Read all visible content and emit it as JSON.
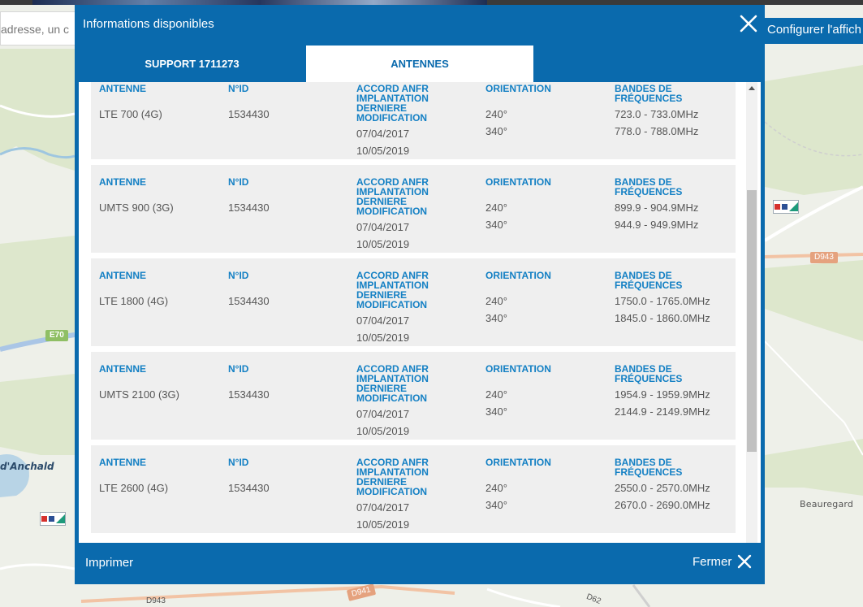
{
  "map": {
    "search_placeholder": "adresse, un c",
    "configure_label": "Configurer l'affich",
    "labels": {
      "anchald": "d'Anchald",
      "beauregard": "Beauregard",
      "e70": "E70",
      "d943": "D943",
      "d943b": "D943",
      "d941": "D941",
      "d62": "D62"
    },
    "colors": {
      "accent": "#0a6aad",
      "land": "#eef0e9",
      "water": "#b8d4e6"
    }
  },
  "dialog": {
    "title": "Informations disponibles",
    "close_icon": "close-icon",
    "tabs": [
      {
        "label": "SUPPORT 1711273",
        "active": false
      },
      {
        "label": "ANTENNES",
        "active": true
      }
    ],
    "headers": {
      "antenne": "ANTENNE",
      "id": "N°ID",
      "accord": "ACCORD ANFR IMPLANTATION DERNIERE MODIFICATION",
      "orientation": "ORIENTATION",
      "bandes": "BANDES DE FRÉQUENCES"
    },
    "antennas": [
      {
        "name": "LTE 700 (4G)",
        "id": "1534430",
        "date1": "07/04/2017",
        "date2": "10/05/2019",
        "orient1": "240°",
        "orient2": "340°",
        "band1": "723.0 - 733.0MHz",
        "band2": "778.0 - 788.0MHz"
      },
      {
        "name": "UMTS 900 (3G)",
        "id": "1534430",
        "date1": "07/04/2017",
        "date2": "10/05/2019",
        "orient1": "240°",
        "orient2": "340°",
        "band1": "899.9 - 904.9MHz",
        "band2": "944.9 - 949.9MHz"
      },
      {
        "name": "LTE 1800 (4G)",
        "id": "1534430",
        "date1": "07/04/2017",
        "date2": "10/05/2019",
        "orient1": "240°",
        "orient2": "340°",
        "band1": "1750.0 - 1765.0MHz",
        "band2": "1845.0 - 1860.0MHz"
      },
      {
        "name": "UMTS 2100 (3G)",
        "id": "1534430",
        "date1": "07/04/2017",
        "date2": "10/05/2019",
        "orient1": "240°",
        "orient2": "340°",
        "band1": "1954.9 - 1959.9MHz",
        "band2": "2144.9 - 2149.9MHz"
      },
      {
        "name": "LTE 2600 (4G)",
        "id": "1534430",
        "date1": "07/04/2017",
        "date2": "10/05/2019",
        "orient1": "240°",
        "orient2": "340°",
        "band1": "2550.0 - 2570.0MHz",
        "band2": "2670.0 - 2690.0MHz"
      }
    ],
    "footer": {
      "print_label": "Imprimer",
      "close_label": "Fermer"
    }
  }
}
